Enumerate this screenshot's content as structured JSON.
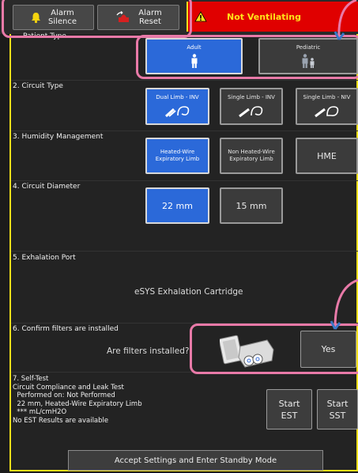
{
  "topbar": {
    "alarm_silence_label": "Alarm\nSilence",
    "alarm_reset_label": "Alarm\nReset",
    "alarm_message": "Not Ventilating"
  },
  "patient_type": {
    "label": "Patient Type",
    "options": [
      {
        "label": "Adult",
        "selected": true
      },
      {
        "label": "Pediatric",
        "selected": false
      }
    ]
  },
  "circuit_type": {
    "label": "2. Circuit Type",
    "options": [
      {
        "label": "Dual Limb - INV",
        "selected": true
      },
      {
        "label": "Single Limb - INV",
        "selected": false
      },
      {
        "label": "Single Limb - NIV",
        "selected": false
      }
    ]
  },
  "humidity": {
    "label": "3. Humidity Management",
    "options": [
      {
        "label": "Heated-Wire\nExpiratory Limb",
        "selected": true
      },
      {
        "label": "Non Heated-Wire\nExpiratory Limb",
        "selected": false
      },
      {
        "label": "HME",
        "selected": false
      }
    ]
  },
  "circuit_diameter": {
    "label": "4. Circuit Diameter",
    "options": [
      {
        "label": "22 mm",
        "selected": true
      },
      {
        "label": "15 mm",
        "selected": false
      }
    ]
  },
  "exhalation_port": {
    "label": "5. Exhalation Port",
    "value": "eSYS Exhalation Cartridge"
  },
  "filters": {
    "label": "6. Confirm filters are installed",
    "question": "Are filters installed?",
    "yes_label": "Yes"
  },
  "self_test": {
    "text": "7. Self-Test\nCircuit Compliance and Leak Test\n  Performed on: Not Performed\n  22 mm, Heated-Wire Expiratory Limb\n  *** mL/cmH2O\nNo EST Results are available",
    "start_est": "Start\nEST",
    "start_sst": "Start\nSST"
  },
  "footer": {
    "accept_label": "Accept Settings and Enter Standby Mode"
  },
  "colors": {
    "selected": "#2b69d9",
    "alarm_bg": "#e00000",
    "alarm_text": "#ffe21a",
    "frame": "#f3e019",
    "callout": "#e87aa8"
  }
}
